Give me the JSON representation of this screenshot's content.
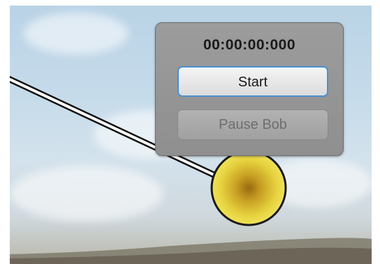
{
  "timer": {
    "display": "00:00:00:000"
  },
  "controls": {
    "start_label": "Start",
    "pause_label": "Pause Bob"
  },
  "colors": {
    "bob_fill": "#e8d53c",
    "bob_center": "#9a6a10",
    "panel_bg": "#969696",
    "start_border": "#4a90d0"
  }
}
